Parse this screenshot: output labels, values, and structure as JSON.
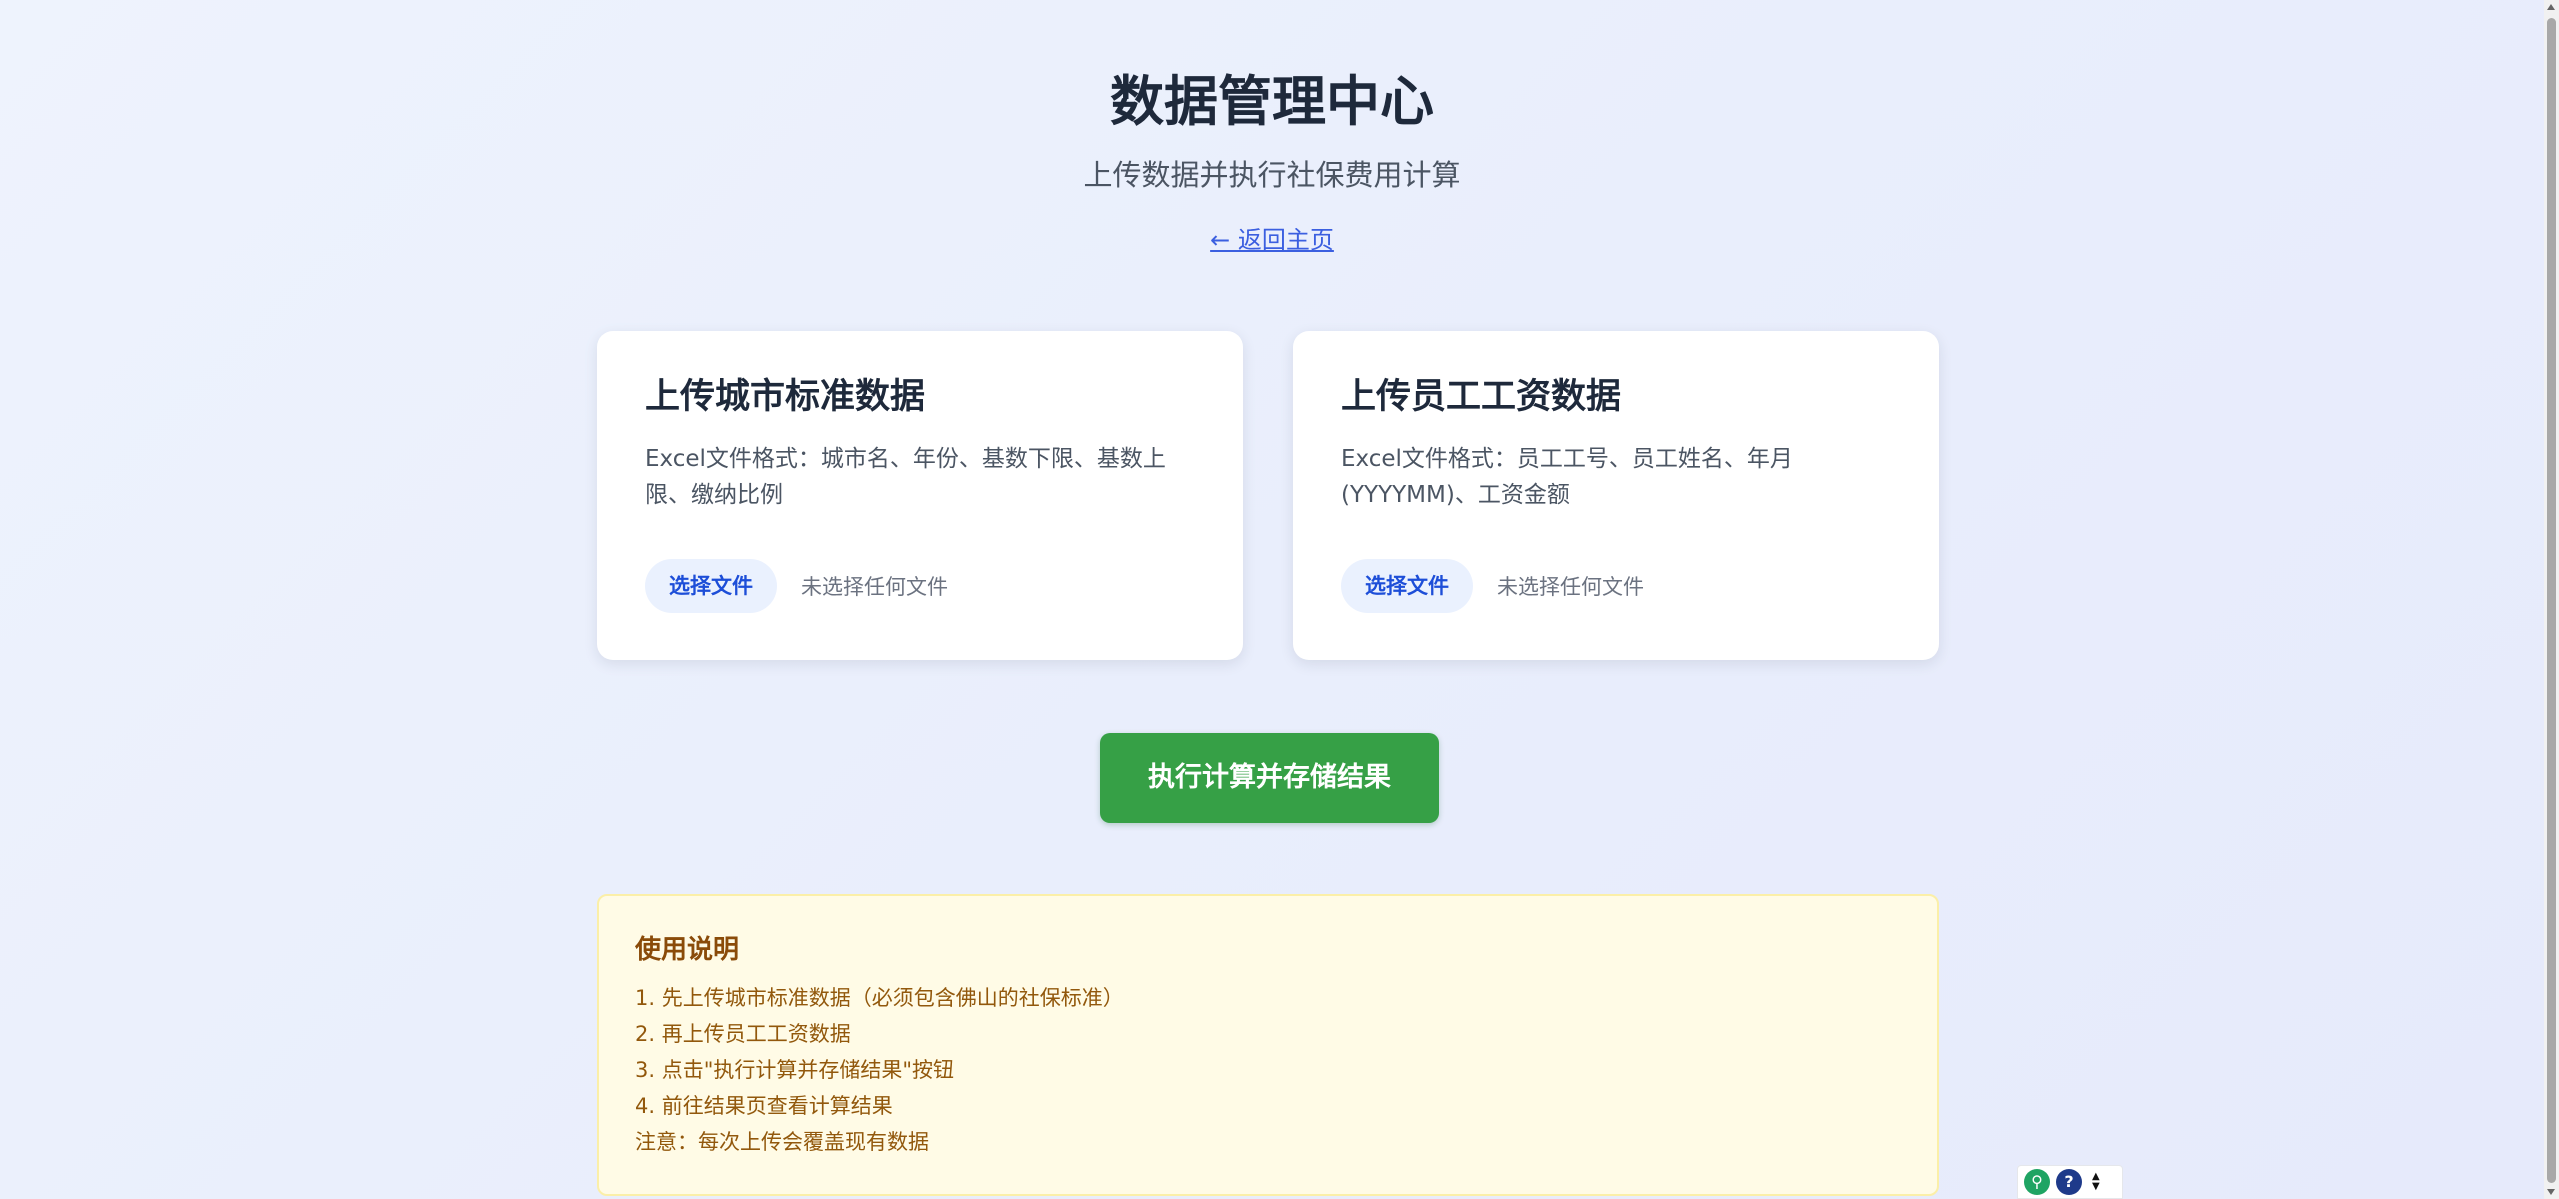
{
  "header": {
    "title": "数据管理中心",
    "subtitle": "上传数据并执行社保费用计算",
    "home_link": "← 返回主页"
  },
  "cards": [
    {
      "title": "上传城市标准数据",
      "description": "Excel文件格式：城市名、年份、基数下限、基数上限、缴纳比例",
      "file_button": "选择文件",
      "file_status": "未选择任何文件"
    },
    {
      "title": "上传员工工资数据",
      "description": "Excel文件格式：员工工号、员工姓名、年月(YYYYMM)、工资金额",
      "file_button": "选择文件",
      "file_status": "未选择任何文件"
    }
  ],
  "actions": {
    "run_label": "执行计算并存储结果"
  },
  "notes": {
    "title": "使用说明",
    "items": [
      "1. 先上传城市标准数据（必须包含佛山的社保标准）",
      "2. 再上传员工工资数据",
      "3. 点击\"执行计算并存储结果\"按钮",
      "4. 前往结果页查看计算结果",
      "注意：每次上传会覆盖现有数据"
    ]
  },
  "widget": {
    "green_icon": "link-icon",
    "blue_icon": "help-icon",
    "green_glyph": "⚲",
    "blue_glyph": "?"
  },
  "colors": {
    "accent_blue": "#3b5fe0",
    "run_button": "#36a046",
    "notes_bg": "#fffbe6",
    "notes_text": "#92580c"
  }
}
